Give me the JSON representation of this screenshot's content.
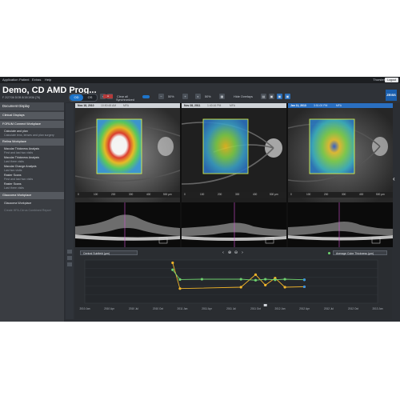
{
  "menu": {
    "items": [
      "Application",
      "Patient",
      "Extras",
      "Help"
    ],
    "user": "Thorsten",
    "logout": "Logout"
  },
  "header": {
    "title": "Demo, CD AMD Prog...",
    "subtitle": "F  2/27/36  DOB  8/15/1936  (76)",
    "od": "OD",
    "os": "OS",
    "clear_all": "Clear all",
    "zoom1": "50%",
    "zoom2": "50%",
    "synchronized": "Synchronized",
    "hide_overlays": "Hide Overlays",
    "logo": "ZEISS"
  },
  "sidebar": {
    "title": "Document Display",
    "sections": [
      {
        "label": "Clinical Displays"
      },
      {
        "label": "FORUM Connect Workplace"
      },
      {
        "label": "Retina Workplace"
      },
      {
        "label": "Glaucoma Workplace"
      }
    ],
    "items": [
      {
        "label": "Calculate and plan",
        "sub": "Calculate lens, lenses and plan surgery"
      },
      {
        "label": "Macular Thickness Analysis",
        "sub": "First and last two visits"
      },
      {
        "label": "Macular Thickness Analysis",
        "sub": "Last three visits"
      },
      {
        "label": "Macular Change Analysis",
        "sub": "Last two visits"
      },
      {
        "label": "Raster Scans",
        "sub": "First and last two visits"
      },
      {
        "label": "Raster Scans",
        "sub": "Last three visits"
      },
      {
        "label": "Glaucoma Workplace",
        "sub": ""
      },
      {
        "label": "Create HFA-Cirrus Combined Report",
        "sub": ""
      }
    ]
  },
  "panels": [
    {
      "date": "Nov 18, 2010",
      "time": "10:50:48 AM",
      "mfa": "MFA"
    },
    {
      "date": "Nov 28, 2011",
      "time": "1:40:16 PM",
      "mfa": "MFA"
    },
    {
      "date": "Jan 11, 2013",
      "time": "3:51:00 PM",
      "mfa": "MFA"
    }
  ],
  "ruler": {
    "ticks": [
      "0",
      "100",
      "200",
      "300",
      "400",
      "500 µm"
    ]
  },
  "chart": {
    "left_select": "Central Subfield (µm)",
    "right_select": "Average Cube Thickness (µm)",
    "colors": {
      "series_a": "#f0b429",
      "series_b": "#6fd36f",
      "series_c": "#3a8fe0"
    }
  },
  "chart_data": {
    "type": "line",
    "x_ticks": [
      "2010 Jan",
      "2010 Apr",
      "2010 Jul",
      "2010 Oct",
      "2011 Jan",
      "2011 Apr",
      "2011 Jul",
      "2011 Oct",
      "2012 Jan",
      "2012 Apr",
      "2012 Jul",
      "2012 Oct",
      "2013 Jan"
    ],
    "series": [
      {
        "points": [
          [
            3.6,
            440
          ],
          [
            3.9,
            255
          ],
          [
            6.4,
            265
          ],
          [
            7.0,
            355
          ],
          [
            7.4,
            280
          ],
          [
            7.8,
            330
          ],
          [
            8.2,
            265
          ],
          [
            9.0,
            268
          ]
        ]
      },
      {
        "points": [
          [
            3.6,
            390
          ],
          [
            3.9,
            320
          ],
          [
            4.8,
            322
          ],
          [
            6.4,
            322
          ],
          [
            7.0,
            315
          ],
          [
            7.4,
            322
          ],
          [
            7.8,
            318
          ],
          [
            8.2,
            322
          ],
          [
            9.0,
            318
          ]
        ]
      },
      {
        "points": [
          [
            9.0,
            318
          ],
          [
            9.0,
            268
          ]
        ]
      }
    ]
  }
}
